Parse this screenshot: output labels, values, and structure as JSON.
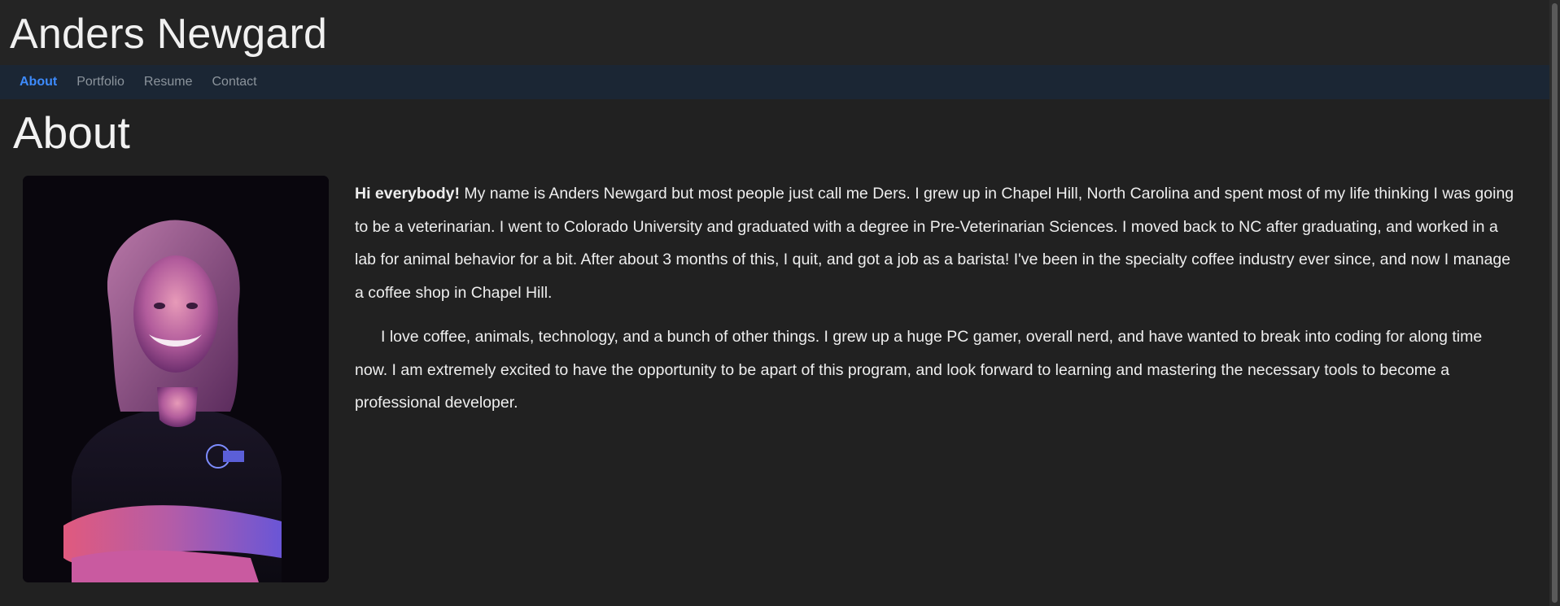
{
  "header": {
    "site_title": "Anders Newgard"
  },
  "nav": {
    "items": [
      {
        "label": "About",
        "active": true
      },
      {
        "label": "Portfolio",
        "active": false
      },
      {
        "label": "Resume",
        "active": false
      },
      {
        "label": "Contact",
        "active": false
      }
    ]
  },
  "main": {
    "page_title": "About",
    "photo_icon": "portrait-photo",
    "bio": {
      "p1_bold": "Hi everybody!",
      "p1_text": " My name is Anders Newgard but most people just call me Ders. I grew up in Chapel Hill, North Carolina and spent most of my life thinking I was going to be a veterinarian. I went to Colorado University and graduated with a degree in Pre-Veterinarian Sciences. I moved back to NC after graduating, and worked in a lab for animal behavior for a bit. After about 3 months of this, I quit, and got a job as a barista! I've been in the specialty coffee industry ever since, and now I manage a coffee shop in Chapel Hill.",
      "p2_text": "I love coffee, animals, technology, and a bunch of other things. I grew up a huge PC gamer, overall nerd, and have wanted to break into coding for along time now. I am extremely excited to have the opportunity to be apart of this program, and look forward to learning and mastering the necessary tools to become a professional developer."
    }
  },
  "colors": {
    "background": "#212121",
    "navbar": "#1b2634",
    "nav_active": "#3d8bfd",
    "nav_inactive": "#8c949c"
  }
}
